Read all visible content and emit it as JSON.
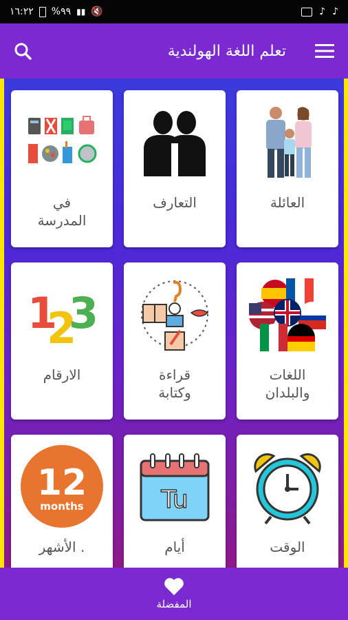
{
  "statusbar": {
    "time": "١٦:٢٢",
    "battery": "%٩٩"
  },
  "header": {
    "title": "تعلم اللغة الهولندية"
  },
  "cards": [
    {
      "label": "العائلة",
      "icon": "family-photo-icon"
    },
    {
      "label": "التعارف",
      "icon": "people-silhouette-icon"
    },
    {
      "label": "في\nالمدرسة",
      "icon": "school-supplies-icon"
    },
    {
      "label": "اللغات\nوالبلدان",
      "icon": "flags-icon"
    },
    {
      "label": "قراءة\nوكتابة",
      "icon": "reading-writing-icon"
    },
    {
      "label": "الارقام",
      "icon": "numbers-123-icon"
    },
    {
      "label": "الوقت",
      "icon": "alarm-clock-icon"
    },
    {
      "label": "أيام",
      "icon": "calendar-icon"
    },
    {
      "label": "الأشهر .",
      "icon": "months-icon"
    }
  ],
  "months_badge": {
    "number": "12",
    "text": "months"
  },
  "calendar_badge": {
    "text": "Tu"
  },
  "numbers_badge": {
    "n1": "1",
    "n2": "2",
    "n3": "3"
  },
  "bottom": {
    "favorites_label": "المفضلة"
  }
}
